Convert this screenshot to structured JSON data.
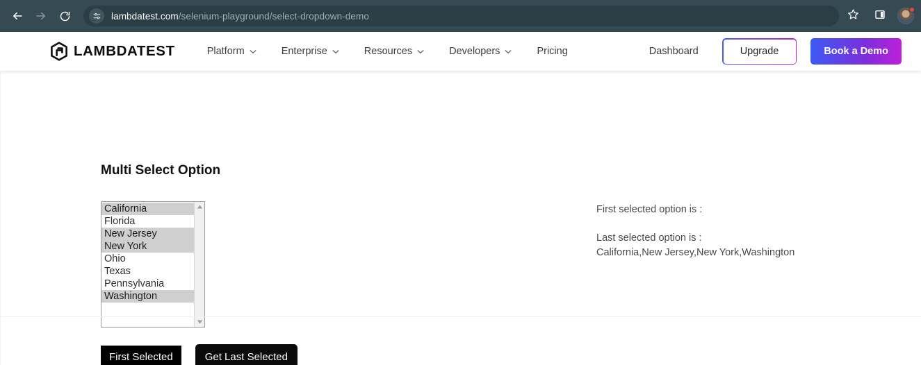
{
  "browser": {
    "back_icon": "back-arrow-icon",
    "forward_icon": "forward-arrow-icon",
    "reload_icon": "reload-icon",
    "site_settings_icon": "tune-sliders-icon",
    "url_host": "lambdatest.com",
    "url_path": "/selenium-playground/select-dropdown-demo",
    "bookmark_icon": "star-icon",
    "side_panel_icon": "side-panel-icon",
    "avatar_icon": "profile-avatar",
    "toolbar_bg": "#354a52",
    "omnibox_bg": "#2b3d45",
    "notification_color": "#e8453c"
  },
  "site_nav": {
    "logo_mark": "lambdatest-hexagon-arrow-logo",
    "logo_text": "LAMBDATEST",
    "links": [
      {
        "label": "Platform",
        "has_chevron": true
      },
      {
        "label": "Enterprise",
        "has_chevron": true
      },
      {
        "label": "Resources",
        "has_chevron": true
      },
      {
        "label": "Developers",
        "has_chevron": true
      },
      {
        "label": "Pricing",
        "has_chevron": false
      }
    ],
    "dashboard_label": "Dashboard",
    "upgrade_label": "Upgrade",
    "demo_label": "Book a Demo",
    "gradient_start": "#3b5bf5",
    "gradient_end": "#c020d8"
  },
  "main": {
    "title": "Multi Select Option",
    "listbox": {
      "options": [
        {
          "label": "California",
          "selected": true
        },
        {
          "label": "Florida",
          "selected": false
        },
        {
          "label": "New Jersey",
          "selected": true
        },
        {
          "label": "New York",
          "selected": true
        },
        {
          "label": "Ohio",
          "selected": false
        },
        {
          "label": "Texas",
          "selected": false
        },
        {
          "label": "Pennsylvania",
          "selected": false
        },
        {
          "label": "Washington",
          "selected": true
        }
      ],
      "selected_bg": "#cfcfcf",
      "scroll_up_icon": "scroll-up-arrow-icon",
      "scroll_down_icon": "scroll-down-arrow-icon"
    },
    "buttons": {
      "first_selected": "First Selected",
      "get_last_selected": "Get Last Selected"
    },
    "results": {
      "first_label": "First selected option is :",
      "first_value": "",
      "last_label": "Last selected option is :",
      "last_value": "California,New Jersey,New York,Washington"
    }
  }
}
